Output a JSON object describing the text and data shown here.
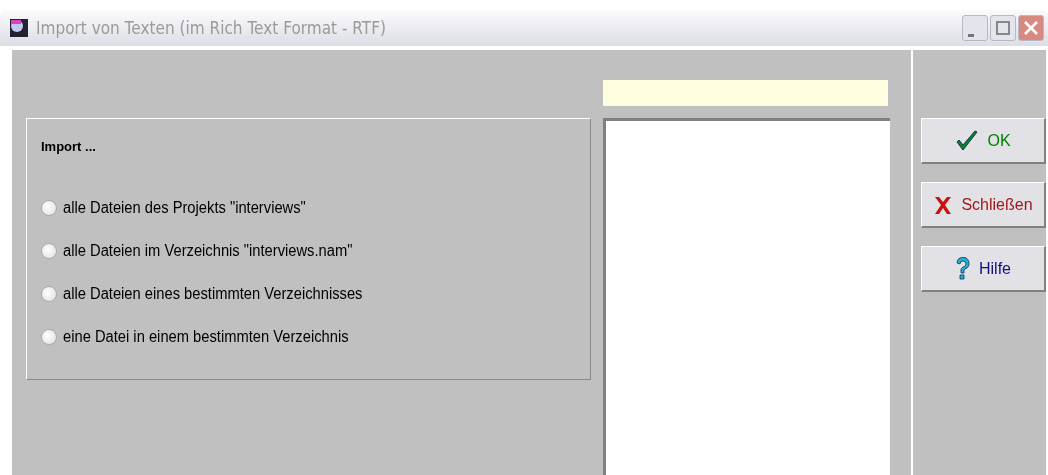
{
  "window": {
    "title": "Import von Texten (im Rich Text Format - RTF)"
  },
  "import_group": {
    "title": "Import ...",
    "options": [
      {
        "label": "alle Dateien des Projekts \"interviews\"",
        "selected": false
      },
      {
        "label": "alle Dateien im Verzeichnis \"interviews.nam\"",
        "selected": false
      },
      {
        "label": "alle Dateien eines bestimmten Verzeichnisses",
        "selected": false
      },
      {
        "label": "eine Datei in einem bestimmten Verzeichnis",
        "selected": false
      }
    ]
  },
  "buttons": [
    {
      "kind": "ok",
      "label": "OK"
    },
    {
      "kind": "close",
      "label": "Schließen"
    },
    {
      "kind": "help",
      "label": "Hilfe"
    }
  ]
}
